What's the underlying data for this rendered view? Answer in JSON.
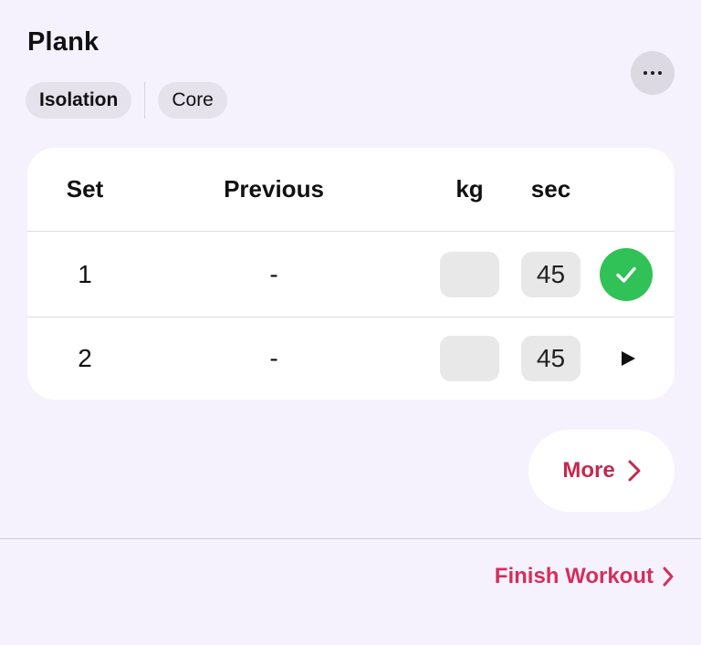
{
  "exercise": {
    "title": "Plank",
    "tags": [
      "Isolation",
      "Core"
    ]
  },
  "table": {
    "headers": {
      "set": "Set",
      "previous": "Previous",
      "kg": "kg",
      "sec": "sec"
    },
    "rows": [
      {
        "set": "1",
        "previous": "-",
        "kg": "",
        "sec": "45",
        "status": "completed"
      },
      {
        "set": "2",
        "previous": "-",
        "kg": "",
        "sec": "45",
        "status": "play"
      }
    ]
  },
  "actions": {
    "more_label": "More",
    "finish_label": "Finish Workout"
  },
  "colors": {
    "accent": "#d62f5a",
    "success": "#30c157",
    "background": "#f5f2fd"
  }
}
